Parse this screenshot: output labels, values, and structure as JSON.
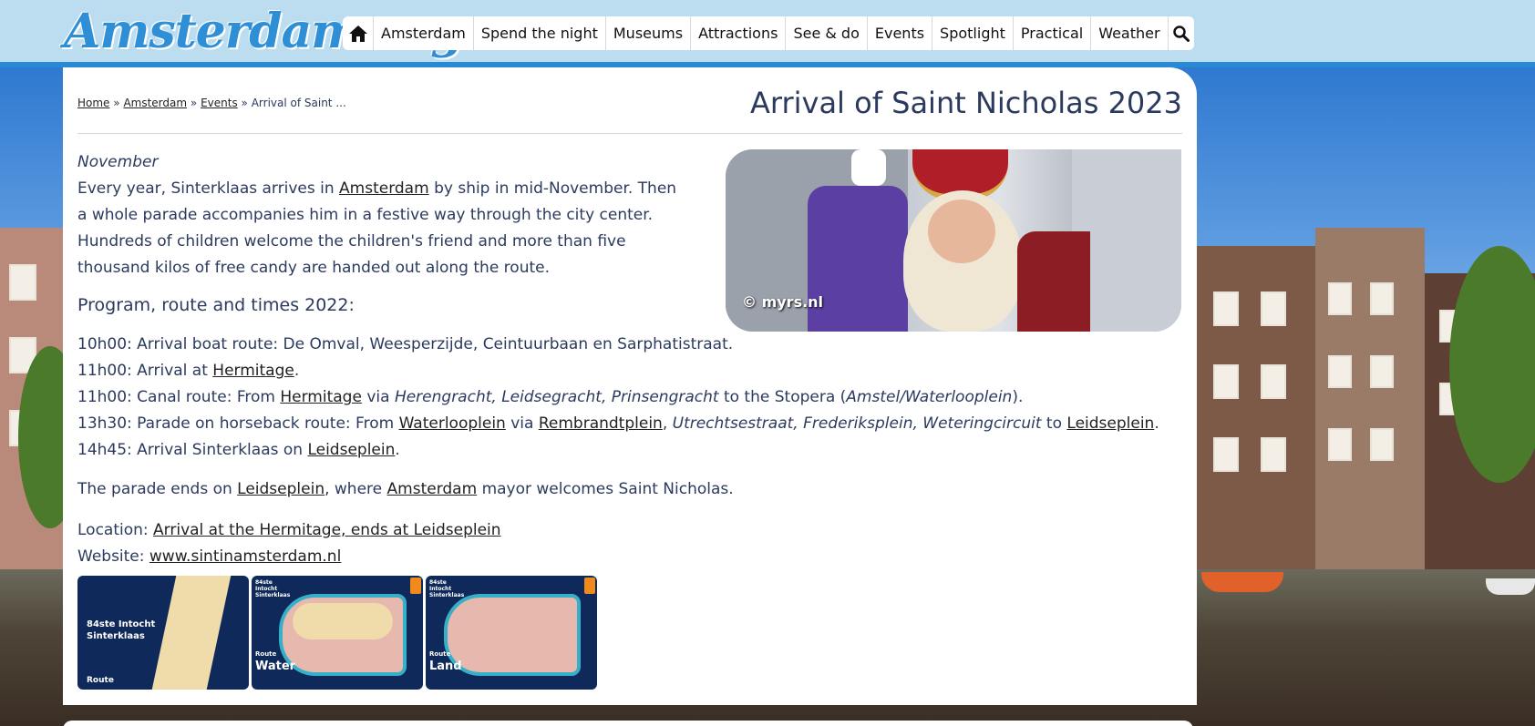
{
  "header": {
    "logo_text": "Amsterdam.org",
    "nav": [
      "Amsterdam",
      "Spend the night",
      "Museums",
      "Attractions",
      "See & do",
      "Events",
      "Spotlight",
      "Practical",
      "Weather"
    ],
    "icons": {
      "home": "home-icon",
      "search": "search-icon"
    }
  },
  "breadcrumb": {
    "home": "Home",
    "sep": "»",
    "amsterdam": "Amsterdam",
    "events": "Events",
    "current": "Arrival of Saint ..."
  },
  "page": {
    "title": "Arrival of Saint Nicholas 2023",
    "month": "November",
    "intro_1": "Every year, Sinterklaas arrives in ",
    "intro_link": "Amsterdam",
    "intro_2": " by ship in mid-November. Then a whole parade accompanies him in a festive way through the city center. Hundreds of children welcome the children's friend and more than five thousand kilos of free candy are handed out along the route.",
    "program_heading": "Program, route and times 2022:",
    "image_credit": "© myrs.nl",
    "program": {
      "l1": "10h00: Arrival boat route: De Omval, Weesperzijde, Ceintuurbaan en Sarphatistraat.",
      "l2_a": "11h00: Arrival at ",
      "l2_link": "Hermitage",
      "l2_b": ".",
      "l3_a": "11h00: Canal route: From ",
      "l3_link": "Hermitage",
      "l3_b": " via ",
      "l3_i": "Herengracht, Leidsegracht, Prinsengracht",
      "l3_c": " to the Stopera (",
      "l3_i2": "Amstel/Waterlooplein",
      "l3_d": ").",
      "l4_a": "13h30: Parade on horseback route: From ",
      "l4_link1": "Waterlooplein",
      "l4_b": " via ",
      "l4_link2": "Rembrandtplein",
      "l4_c": ", ",
      "l4_i": "Utrechtsestraat, Frederiksplein, Weteringcircuit",
      "l4_d": " to ",
      "l4_link3": "Leidseplein",
      "l4_e": ".",
      "l5_a": "14h45: Arrival Sinterklaas on ",
      "l5_link": "Leidseplein",
      "l5_b": "."
    },
    "ends_a": "The parade ends on ",
    "ends_link1": "Leidseplein",
    "ends_b": ", where ",
    "ends_link2": "Amsterdam",
    "ends_c": " mayor welcomes Saint Nicholas.",
    "location_label": "Location: ",
    "location_link": "Arrival at the Hermitage, ends at Leidseplein",
    "website_label": "Website: ",
    "website_link": "www.sintinamsterdam.nl",
    "thumbs": [
      {
        "t1": "84ste Intocht",
        "t2": "Sinterklaas",
        "t3": "Route"
      },
      {
        "t1": "84ste Intocht Sinterklaas",
        "t2": "Route",
        "t3": "Water"
      },
      {
        "t1": "84ste Intocht Sinterklaas",
        "t2": "Route",
        "t3": "Land"
      }
    ]
  },
  "colors": {
    "topbar": "#bcdcef",
    "accent": "#2a89d3",
    "text": "#2b3a5e"
  }
}
